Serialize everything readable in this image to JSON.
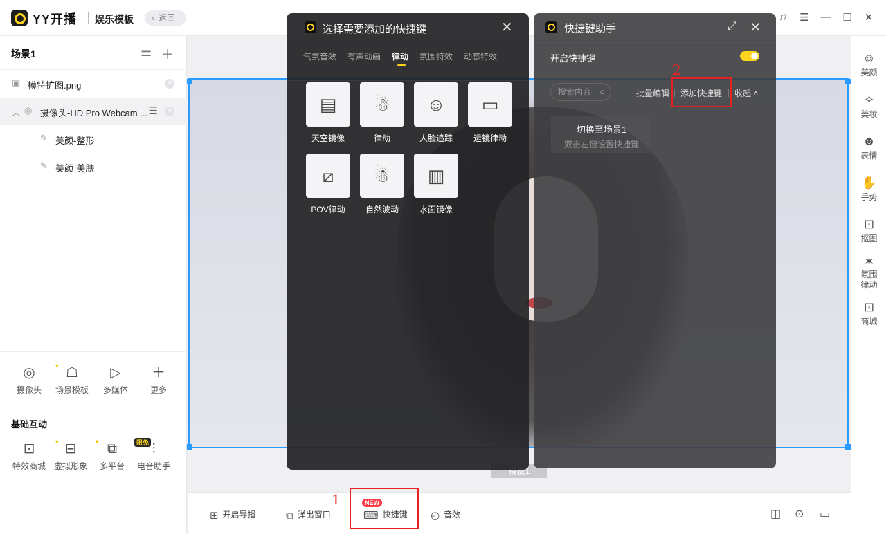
{
  "app": {
    "name": "YY开播",
    "page_title": "娱乐模板",
    "back_label": "返回"
  },
  "window_controls": {
    "support": "♫",
    "menu": "☰",
    "minimize": "—",
    "maximize": "☐",
    "close": "✕"
  },
  "left_panel": {
    "scene_title": "场景1",
    "sources": [
      {
        "label": "模特扩图.png",
        "icon": "image-icon"
      },
      {
        "label": "摄像头-HD Pro Webcam ...",
        "icon": "camera-icon"
      },
      {
        "label": "美颜-整形",
        "icon": "beauty-icon"
      },
      {
        "label": "美颜-美肤",
        "icon": "beauty-icon"
      }
    ],
    "tools": [
      {
        "label": "摄像头",
        "icon": "camera-icon"
      },
      {
        "label": "场景模板",
        "icon": "template-icon",
        "vip": true
      },
      {
        "label": "多媒体",
        "icon": "media-icon"
      },
      {
        "label": "更多",
        "icon": "plus-icon"
      }
    ],
    "interaction_title": "基础互动",
    "interactions": [
      {
        "label": "特效商城",
        "icon": "shop-icon"
      },
      {
        "label": "虚拟形象",
        "icon": "avatar-icon",
        "vip": true
      },
      {
        "label": "多平台",
        "icon": "multiplatform-icon",
        "vip": true
      },
      {
        "label": "电音助手",
        "icon": "voice-icon",
        "badge": "限免"
      }
    ]
  },
  "right_rail": [
    {
      "label": "美颜",
      "icon": "beauty-icon"
    },
    {
      "label": "美妆",
      "icon": "makeup-icon"
    },
    {
      "label": "表情",
      "icon": "emoji-icon"
    },
    {
      "label": "手势",
      "icon": "gesture-icon"
    },
    {
      "label": "抠图",
      "icon": "cutout-icon"
    },
    {
      "label": "氛围律动",
      "icon": "ambient-icon"
    },
    {
      "label": "商城",
      "icon": "shop-icon"
    }
  ],
  "canvas": {
    "scene_tag": "模板1"
  },
  "bottom_bar": {
    "items": [
      {
        "label": "开启导播",
        "icon": "director-icon"
      },
      {
        "label": "弹出窗口",
        "icon": "popup-icon"
      },
      {
        "label": "快捷键",
        "icon": "keyboard-icon",
        "badge": "NEW"
      },
      {
        "label": "音效",
        "icon": "sound-icon"
      }
    ]
  },
  "select_panel": {
    "title": "选择需要添加的快捷键",
    "tabs": [
      "气氛音效",
      "有声动画",
      "律动",
      "氛围特效",
      "动感特效"
    ],
    "active_tab": 2,
    "effects": [
      {
        "label": "天空镜像",
        "icon": "sky-mirror-icon"
      },
      {
        "label": "律动",
        "icon": "dance-icon"
      },
      {
        "label": "人脸追踪",
        "icon": "face-track-icon"
      },
      {
        "label": "运镜律动",
        "icon": "camera-move-icon"
      },
      {
        "label": "POV律动",
        "icon": "pov-icon"
      },
      {
        "label": "自然波动",
        "icon": "wave-icon"
      },
      {
        "label": "水面镜像",
        "icon": "water-mirror-icon"
      }
    ]
  },
  "hotkey_panel": {
    "title": "快捷键助手",
    "enable_label": "开启快捷键",
    "enabled": true,
    "search_placeholder": "搜索内容",
    "actions": {
      "batch_edit": "批量编辑",
      "add_hotkey": "添加快捷键",
      "collapse": "收起"
    },
    "card": {
      "title": "切换至场景1",
      "hint": "双击左键设置快捷键"
    }
  },
  "annotations": {
    "step1": "1",
    "step2": "2"
  },
  "colors": {
    "accent": "#ffd51f",
    "selection": "#2a9bff",
    "annotation": "#e82020"
  }
}
